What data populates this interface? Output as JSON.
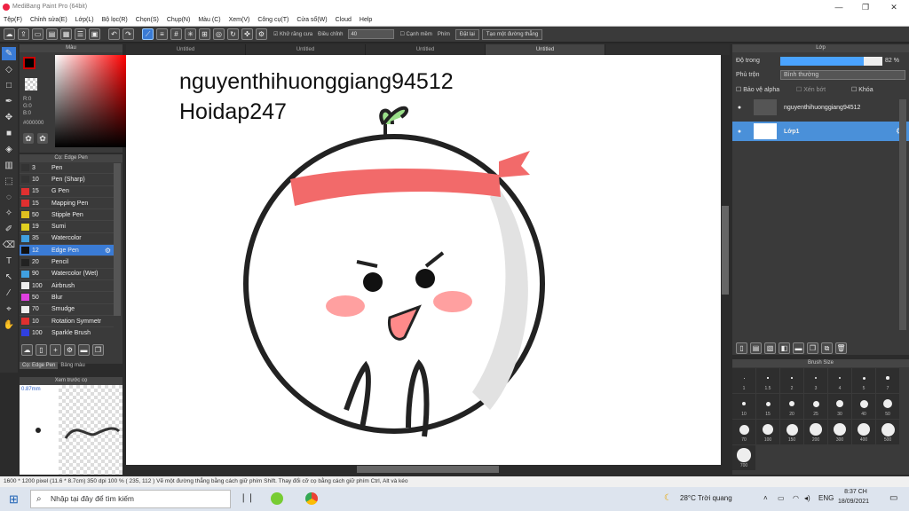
{
  "window": {
    "title": "MediBang Paint Pro (64bit)"
  },
  "menu": [
    "Tệp(F)",
    "Chỉnh sửa(E)",
    "Lớp(L)",
    "Bộ lọc(R)",
    "Chọn(S)",
    "Chụp(N)",
    "Màu (C)",
    "Xem(V)",
    "Công cụ(T)",
    "Cửa sổ(W)",
    "Cloud",
    "Help"
  ],
  "toolbar": {
    "antialias": "Khử răng cưa",
    "correction_label": "Điều chỉnh",
    "correction_value": "40",
    "edge_label": "Cạnh mềm",
    "key_label": "Phím",
    "reset": "Đặt lại",
    "straight_line": "Tạo một đường thẳng"
  },
  "color_panel": {
    "title": "Màu",
    "r": "R:0",
    "g": "G:0",
    "b": "B:0",
    "hex": "#000000"
  },
  "brush_panel": {
    "title": "Cọ: Edge Pen",
    "brushes": [
      {
        "size": "3",
        "name": "Pen",
        "color": "#333333"
      },
      {
        "size": "10",
        "name": "Pen (Sharp)",
        "color": "#333333"
      },
      {
        "size": "15",
        "name": "G Pen",
        "color": "#e03030"
      },
      {
        "size": "15",
        "name": "Mapping Pen",
        "color": "#e03030"
      },
      {
        "size": "50",
        "name": "Stipple Pen",
        "color": "#e0c020"
      },
      {
        "size": "19",
        "name": "Sumi",
        "color": "#e0d020"
      },
      {
        "size": "35",
        "name": "Watercolor",
        "color": "#40a0e0"
      },
      {
        "size": "12",
        "name": "Edge Pen",
        "color": "#111111"
      },
      {
        "size": "20",
        "name": "Pencil",
        "color": "#222222"
      },
      {
        "size": "90",
        "name": "Watercolor (Wet)",
        "color": "#40a0e0"
      },
      {
        "size": "100",
        "name": "Airbrush",
        "color": "#eeeeee"
      },
      {
        "size": "50",
        "name": "Blur",
        "color": "#e040e0"
      },
      {
        "size": "70",
        "name": "Smudge",
        "color": "#eeeeee"
      },
      {
        "size": "10",
        "name": "Rotation Symmetr",
        "color": "#e03030"
      },
      {
        "size": "100",
        "name": "Sparkle Brush",
        "color": "#3040e0"
      }
    ],
    "tab1": "Cọ: Edge Pen",
    "tab2": "Bảng màu"
  },
  "preview": {
    "title": "Xem trước cọ",
    "size": "0.87mm"
  },
  "tabs": [
    "Untitled",
    "Untitled",
    "Untitled",
    "Untitled"
  ],
  "canvas": {
    "line1": "nguyenthihuonggiang94512",
    "line2": "Hoidap247"
  },
  "status": {
    "text": "1600 * 1200 pixel    (11.6 * 8.7cm)  350 dpi  100 %   ( 235, 112 )   Vẽ một đường thẳng bằng cách giữ phím Shift. Thay đổi cỡ cọ bằng cách giữ phím Ctrl, Alt và kéo"
  },
  "layer_panel": {
    "title": "Lớp",
    "opacity_label": "Độ trong",
    "opacity_value": "82 %",
    "opacity": 0.82,
    "blend_label": "Phủ trộn",
    "blend_value": "Bình thường",
    "alpha": "Bảo vệ alpha",
    "clip": "Xén bớt",
    "lock": "Khóa",
    "layers": [
      "nguyenthihuonggiang94512",
      "Lớp1"
    ]
  },
  "size_panel": {
    "title": "Brush Size",
    "sizes": [
      "1",
      "1.5",
      "2",
      "3",
      "4",
      "5",
      "7",
      "10",
      "15",
      "20",
      "25",
      "30",
      "40",
      "50",
      "70",
      "100",
      "150",
      "200",
      "300",
      "400",
      "500",
      "700"
    ]
  },
  "taskbar": {
    "search": "Nhập tại đây để tìm kiếm",
    "weather": "28°C  Trời quang",
    "lang": "ENG",
    "time": "8:37 CH",
    "date": "18/09/2021"
  }
}
